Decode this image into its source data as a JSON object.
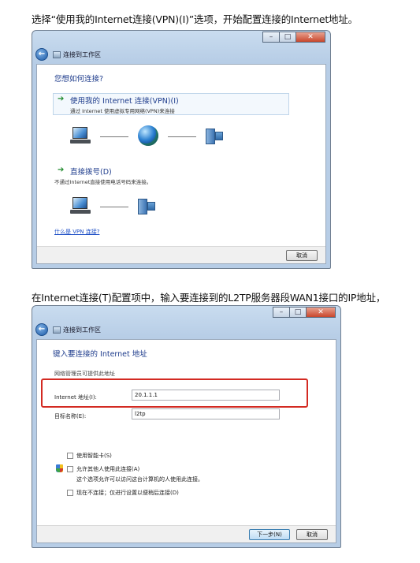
{
  "captions": {
    "first": "选择“使用我的Internet连接(VPN)(I)”选项，开始配置连接的Internet地址。",
    "second": "在Internet连接(T)配置项中，输入要连接到的L2TP服务器段WAN1接口的IP地址，"
  },
  "window1": {
    "title": "连接到工作区",
    "heading": "您想如何连接?",
    "options": [
      {
        "title": "使用我的 Internet 连接(VPN)(I)",
        "description": "通过 Internet 使用虚拟专用网络(VPN)来连接"
      },
      {
        "title": "直接拨号(D)",
        "description": "不通过Internet直接使用电话号码来连接。"
      }
    ],
    "help_link": "什么是 VPN 连接?",
    "cancel_button": "取消"
  },
  "window2": {
    "title": "连接到工作区",
    "heading": "键入要连接的 Internet 地址",
    "hint": "网络管理员可提供此地址",
    "address_label": "Internet 地址(I):",
    "address_value": "20.1.1.1",
    "destination_label": "目标名称(E):",
    "destination_value": "l2tp",
    "checkboxes": {
      "smart_card": "使用智能卡(S)",
      "allow_others": "允许其他人使用此连接(A)",
      "allow_others_note": "这个选项允许可以访问这台计算机的人使用此连接。",
      "dont_connect": "现在不连接；仅进行设置以便稍后连接(D)"
    },
    "next_button": "下一步(N)",
    "cancel_button": "取消"
  },
  "colors": {
    "highlight_border": "#d32a22",
    "heading_blue": "#1e3c8c",
    "link_blue": "#1a4cc5"
  },
  "icons": [
    "back-arrow-icon",
    "network-icon",
    "green-arrow-icon",
    "computer-icon",
    "globe-icon",
    "server-icon",
    "uac-shield-icon"
  ]
}
